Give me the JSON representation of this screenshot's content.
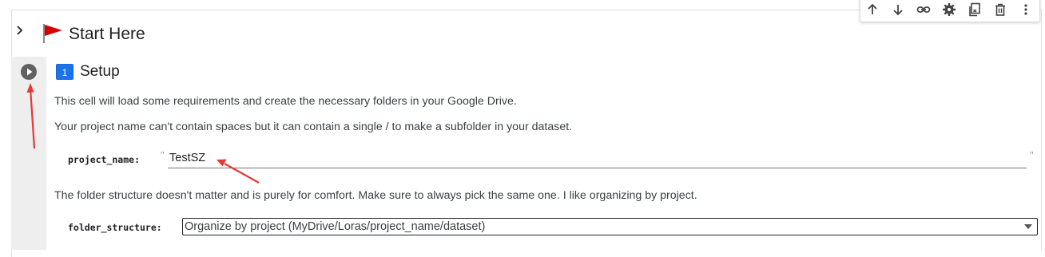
{
  "section": {
    "title": "Start Here",
    "flag_color": "#d50000"
  },
  "toolbar": {
    "icons": [
      "arrow-up-icon",
      "arrow-down-icon",
      "link-icon",
      "gear-icon",
      "mirror-cell-icon",
      "trash-icon",
      "more-vert-icon"
    ]
  },
  "cell": {
    "badge": "1",
    "title": "Setup",
    "description_1": "This cell will load some requirements and create the necessary folders in your Google Drive.",
    "description_2": "Your project name can't contain spaces but it can contain a single / to make a subfolder in your dataset.",
    "project_name_label": "project_name:",
    "project_name_value": "TestSZ",
    "description_3": "The folder structure doesn't matter and is purely for comfort. Make sure to always pick the same one. I like organizing by project.",
    "folder_structure_label": "folder_structure:",
    "folder_structure_value": "Organize by project (MyDrive/Loras/project_name/dataset)"
  },
  "colors": {
    "accent_blue": "#1a73e8",
    "annotation_red": "#e53935",
    "gutter": "#eeeeee"
  }
}
